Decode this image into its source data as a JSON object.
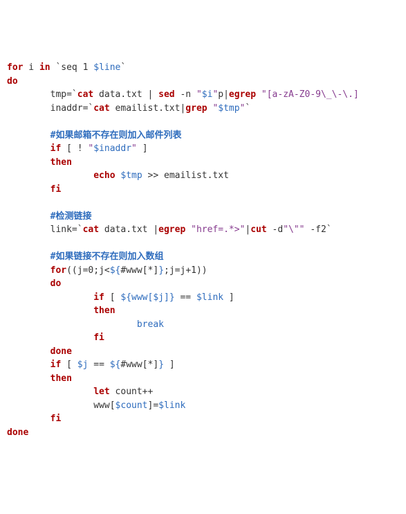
{
  "lines": [
    [
      {
        "cls": "kw",
        "t": "for"
      },
      {
        "cls": "op",
        "t": " i "
      },
      {
        "cls": "kw",
        "t": "in"
      },
      {
        "cls": "op",
        "t": " `seq 1 "
      },
      {
        "cls": "var",
        "t": "$line"
      },
      {
        "cls": "op",
        "t": "`"
      }
    ],
    [
      {
        "cls": "kw",
        "t": "do"
      }
    ],
    [
      {
        "cls": "op",
        "t": "        tmp=`"
      },
      {
        "cls": "cmd",
        "t": "cat"
      },
      {
        "cls": "op",
        "t": " data.txt | "
      },
      {
        "cls": "cmd",
        "t": "sed"
      },
      {
        "cls": "op",
        "t": " -n "
      },
      {
        "cls": "str",
        "t": "\""
      },
      {
        "cls": "var",
        "t": "$i"
      },
      {
        "cls": "str",
        "t": "\""
      },
      {
        "cls": "op",
        "t": "p|"
      },
      {
        "cls": "cmd",
        "t": "egrep"
      },
      {
        "cls": "op",
        "t": " "
      },
      {
        "cls": "str",
        "t": "\"[a-zA-Z0-9\\_\\-\\.]"
      }
    ],
    [
      {
        "cls": "op",
        "t": "        inaddr=`"
      },
      {
        "cls": "cmd",
        "t": "cat"
      },
      {
        "cls": "op",
        "t": " emailist.txt|"
      },
      {
        "cls": "cmd",
        "t": "grep"
      },
      {
        "cls": "op",
        "t": " "
      },
      {
        "cls": "str",
        "t": "\""
      },
      {
        "cls": "var",
        "t": "$tmp"
      },
      {
        "cls": "str",
        "t": "\""
      },
      {
        "cls": "op",
        "t": "`"
      }
    ],
    [
      {
        "cls": "op",
        "t": ""
      }
    ],
    [
      {
        "cls": "op",
        "t": "        "
      },
      {
        "cls": "cmt",
        "t": "#如果邮箱不存在则加入邮件列表"
      }
    ],
    [
      {
        "cls": "op",
        "t": "        "
      },
      {
        "cls": "kw",
        "t": "if"
      },
      {
        "cls": "op",
        "t": " [ ! "
      },
      {
        "cls": "str",
        "t": "\""
      },
      {
        "cls": "var",
        "t": "$inaddr"
      },
      {
        "cls": "str",
        "t": "\""
      },
      {
        "cls": "op",
        "t": " ]"
      }
    ],
    [
      {
        "cls": "op",
        "t": "        "
      },
      {
        "cls": "kw",
        "t": "then"
      }
    ],
    [
      {
        "cls": "op",
        "t": "                "
      },
      {
        "cls": "cmd",
        "t": "echo"
      },
      {
        "cls": "op",
        "t": " "
      },
      {
        "cls": "var",
        "t": "$tmp"
      },
      {
        "cls": "op",
        "t": " >> emailist.txt"
      }
    ],
    [
      {
        "cls": "op",
        "t": "        "
      },
      {
        "cls": "kw",
        "t": "fi"
      }
    ],
    [
      {
        "cls": "op",
        "t": ""
      }
    ],
    [
      {
        "cls": "op",
        "t": "        "
      },
      {
        "cls": "cmt",
        "t": "#检测链接"
      }
    ],
    [
      {
        "cls": "op",
        "t": "        link=`"
      },
      {
        "cls": "cmd",
        "t": "cat"
      },
      {
        "cls": "op",
        "t": " data.txt |"
      },
      {
        "cls": "cmd",
        "t": "egrep"
      },
      {
        "cls": "op",
        "t": " "
      },
      {
        "cls": "str",
        "t": "\"href=.*>\""
      },
      {
        "cls": "op",
        "t": "|"
      },
      {
        "cls": "cmd",
        "t": "cut"
      },
      {
        "cls": "op",
        "t": " -d"
      },
      {
        "cls": "str",
        "t": "\"\\\"\""
      },
      {
        "cls": "op",
        "t": " -f2`"
      }
    ],
    [
      {
        "cls": "op",
        "t": ""
      }
    ],
    [
      {
        "cls": "op",
        "t": "        "
      },
      {
        "cls": "cmt",
        "t": "#如果链接不存在则加入数组"
      }
    ],
    [
      {
        "cls": "op",
        "t": "        "
      },
      {
        "cls": "kw",
        "t": "for"
      },
      {
        "cls": "op",
        "t": "((j=0;j<"
      },
      {
        "cls": "var",
        "t": "${"
      },
      {
        "cls": "op",
        "t": "#www[*]"
      },
      {
        "cls": "var",
        "t": "}"
      },
      {
        "cls": "op",
        "t": ";j=j+1))"
      }
    ],
    [
      {
        "cls": "op",
        "t": "        "
      },
      {
        "cls": "kw",
        "t": "do"
      }
    ],
    [
      {
        "cls": "op",
        "t": "                "
      },
      {
        "cls": "kw",
        "t": "if"
      },
      {
        "cls": "op",
        "t": " [ "
      },
      {
        "cls": "var",
        "t": "${www["
      },
      {
        "cls": "var",
        "t": "$j"
      },
      {
        "cls": "var",
        "t": "]}"
      },
      {
        "cls": "op",
        "t": " == "
      },
      {
        "cls": "var",
        "t": "$link"
      },
      {
        "cls": "op",
        "t": " ]"
      }
    ],
    [
      {
        "cls": "op",
        "t": "                "
      },
      {
        "cls": "kw",
        "t": "then"
      }
    ],
    [
      {
        "cls": "op",
        "t": "                        "
      },
      {
        "cls": "brk",
        "t": "break"
      }
    ],
    [
      {
        "cls": "op",
        "t": "                "
      },
      {
        "cls": "kw",
        "t": "fi"
      }
    ],
    [
      {
        "cls": "op",
        "t": "        "
      },
      {
        "cls": "kw",
        "t": "done"
      }
    ],
    [
      {
        "cls": "op",
        "t": "        "
      },
      {
        "cls": "kw",
        "t": "if"
      },
      {
        "cls": "op",
        "t": " [ "
      },
      {
        "cls": "var",
        "t": "$j"
      },
      {
        "cls": "op",
        "t": " == "
      },
      {
        "cls": "var",
        "t": "${"
      },
      {
        "cls": "op",
        "t": "#www[*]"
      },
      {
        "cls": "var",
        "t": "}"
      },
      {
        "cls": "op",
        "t": " ]"
      }
    ],
    [
      {
        "cls": "op",
        "t": "        "
      },
      {
        "cls": "kw",
        "t": "then"
      }
    ],
    [
      {
        "cls": "op",
        "t": "                "
      },
      {
        "cls": "cmd",
        "t": "let"
      },
      {
        "cls": "op",
        "t": " count++"
      }
    ],
    [
      {
        "cls": "op",
        "t": "                www["
      },
      {
        "cls": "var",
        "t": "$count"
      },
      {
        "cls": "op",
        "t": "]="
      },
      {
        "cls": "var",
        "t": "$link"
      }
    ],
    [
      {
        "cls": "op",
        "t": "        "
      },
      {
        "cls": "kw",
        "t": "fi"
      }
    ],
    [
      {
        "cls": "kw",
        "t": "done"
      }
    ]
  ]
}
